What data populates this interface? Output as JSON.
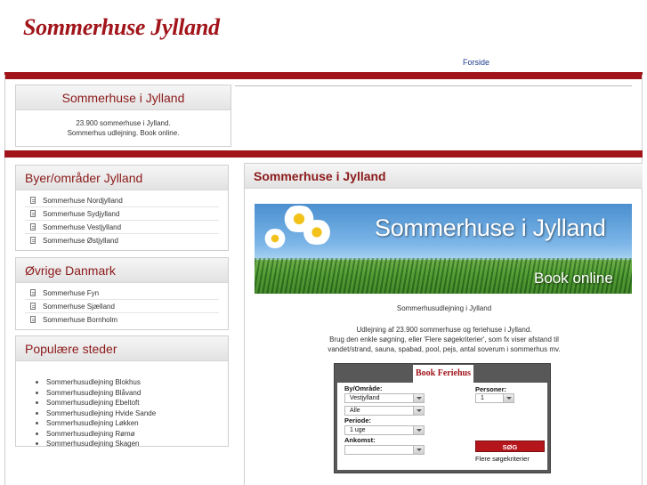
{
  "header": {
    "site_title": "Sommerhuse Jylland",
    "nav_link": "Forside"
  },
  "intro": {
    "title": "Sommerhuse i Jylland",
    "line1": "23.900 sommerhuse i Jylland.",
    "line2": "Sommerhus udlejning. Book online."
  },
  "sidebar": {
    "regions": {
      "title": "Byer/områder Jylland",
      "items": [
        "Sommerhuse Nordjylland",
        "Sommerhuse Sydjylland",
        "Sommerhuse Vestjylland",
        "Sommerhuse Østjylland"
      ]
    },
    "denmark": {
      "title": "Øvrige Danmark",
      "items": [
        "Sommerhuse Fyn",
        "Sommerhuse Sjælland",
        "Sommerhuse Bornholm"
      ]
    },
    "popular": {
      "title": "Populære steder",
      "items": [
        "Sommerhusudlejning Blokhus",
        "Sommerhusudlejning Blåvand",
        "Sommerhusudlejning Ebeltoft",
        "Sommerhusudlejning Hvide Sande",
        "Sommerhusudlejning Løkken",
        "Sommerhusudlejning Rømø",
        "Sommerhusudlejning Skagen"
      ]
    }
  },
  "main": {
    "title": "Sommerhuse i Jylland",
    "banner_title": "Sommerhuse i Jylland",
    "banner_sub": "Book online",
    "caption": "Sommerhusudlejning i Jylland",
    "desc1": "Udlejning af 23.900 sommerhuse og feriehuse i Jylland.",
    "desc2": "Brug den enkle søgning, eller 'Flere søgekriterier', som fx viser afstand til",
    "desc3": "vandet/strand, sauna, spabad, pool, pejs, antal soverum i sommerhus mv."
  },
  "booking": {
    "title": "Book Feriehus",
    "area_label": "By/Område:",
    "area_value": "Vestjylland",
    "sub_value": "Alle",
    "period_label": "Periode:",
    "period_value": "1 uge",
    "arrival_label": "Ankomst:",
    "arrival_value": "",
    "persons_label": "Personer:",
    "persons_value": "1",
    "search_button": "SØG",
    "more_criteria": "Flere søgekriterier"
  }
}
